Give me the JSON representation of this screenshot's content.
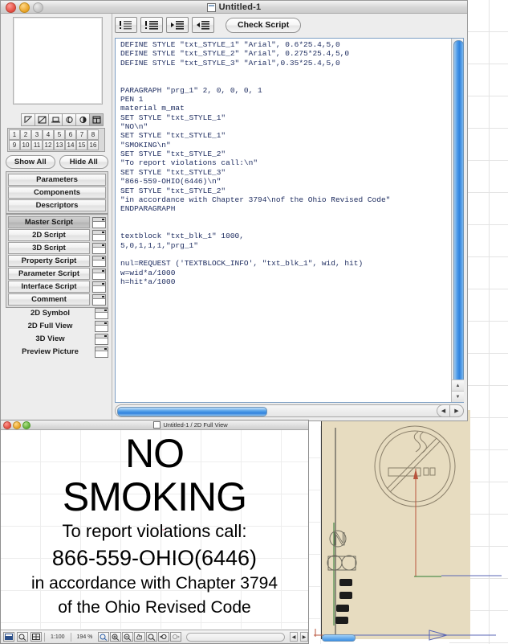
{
  "app": {
    "window_title": "Untitled-1",
    "doc_icon": "document-icon"
  },
  "toolbar": {
    "buttons": [
      {
        "name": "check-syntax-icon",
        "label": "!☷"
      },
      {
        "name": "line-numbers-icon",
        "label": "!≡"
      },
      {
        "name": "indent-right-icon",
        "label": "▶≡"
      },
      {
        "name": "indent-left-icon",
        "label": "◀≡"
      }
    ],
    "check_script_label": "Check Script"
  },
  "left_panel": {
    "preview_label": "preview-thumbnail",
    "icon_row": [
      {
        "name": "edit-pencil-icon",
        "glyph": "◱"
      },
      {
        "name": "fill-icon",
        "glyph": "▨"
      },
      {
        "name": "floor-plan-icon",
        "glyph": "⎔"
      },
      {
        "name": "globe-3d-icon",
        "glyph": "◔"
      },
      {
        "name": "shade-3d-icon",
        "glyph": "◕"
      },
      {
        "name": "script-window-icon",
        "glyph": "▤"
      }
    ],
    "numbers_row1": [
      "1",
      "2",
      "3",
      "4",
      "5",
      "6",
      "7",
      "8"
    ],
    "numbers_row2": [
      "9",
      "10",
      "11",
      "12",
      "13",
      "14",
      "15",
      "16"
    ],
    "show_all_label": "Show All",
    "hide_all_label": "Hide All",
    "top_group": [
      {
        "label": "Parameters",
        "selected": false
      },
      {
        "label": "Components",
        "selected": false
      },
      {
        "label": "Descriptors",
        "selected": false
      }
    ],
    "script_group": [
      {
        "label": "Master Script",
        "selected": true
      },
      {
        "label": "2D Script",
        "selected": false
      },
      {
        "label": "3D Script",
        "selected": false
      },
      {
        "label": "Property Script",
        "selected": false
      },
      {
        "label": "Parameter Script",
        "selected": false
      },
      {
        "label": "Interface Script",
        "selected": false
      },
      {
        "label": "Comment",
        "selected": false
      }
    ],
    "views": [
      {
        "label": "2D Symbol"
      },
      {
        "label": "2D Full View"
      },
      {
        "label": "3D View"
      },
      {
        "label": "Preview Picture"
      }
    ]
  },
  "editor": {
    "code": "DEFINE STYLE \"txt_STYLE_1\" \"Arial\", 0.6*25.4,5,0\nDEFINE STYLE \"txt_STYLE_2\" \"Arial\", 0.275*25.4,5,0\nDEFINE STYLE \"txt_STYLE_3\" \"Arial\",0.35*25.4,5,0\n\n\nPARAGRAPH \"prg_1\" 2, 0, 0, 0, 1\nPEN 1\nmaterial m_mat\nSET STYLE \"txt_STYLE_1\"\n\"NO\\n\"\nSET STYLE \"txt_STYLE_1\"\n\"SMOKING\\n\"\nSET STYLE \"txt_STYLE_2\"\n\"To report violations call:\\n\"\nSET STYLE \"txt_STYLE_3\"\n\"866-559-OHIO(6446)\\n\"\nSET STYLE \"txt_STYLE_2\"\n\"in accordance with Chapter 3794\\nof the Ohio Revised Code\"\nENDPARAGRAPH\n\n\ntextblock \"txt_blk_1\" 1000,\n5,0,1,1,1,\"prg_1\"\n\nnul=REQUEST ('TEXTBLOCK_INFO', \"txt_blk_1\", wid, hit)\nw=wid*a/1000\nh=hit*a/1000",
    "text_color": "#1b2a5e"
  },
  "view2d": {
    "title": "Untitled-1 / 2D Full View",
    "sign_lines": [
      "NO",
      "SMOKING",
      "To report violations call:",
      "866-559-OHIO(6446)",
      "in accordance with Chapter 3794",
      "of the Ohio Revised Code"
    ],
    "status": {
      "scale": "1:100",
      "zoom": "194 %",
      "tool_icons": [
        {
          "name": "layer-icon",
          "glyph": "▤"
        },
        {
          "name": "zoom-fit-icon",
          "glyph": "⌕"
        },
        {
          "name": "grid-icon",
          "glyph": "▦"
        }
      ],
      "zoom_tools": [
        {
          "name": "zoom-selected-icon",
          "glyph": "⌕"
        },
        {
          "name": "zoom-in-icon",
          "glyph": "⌕"
        },
        {
          "name": "zoom-out-icon",
          "glyph": "⌕"
        },
        {
          "name": "pan-hand-icon",
          "glyph": "✋"
        },
        {
          "name": "zoom-fit-window-icon",
          "glyph": "⌕"
        },
        {
          "name": "zoom-prev-icon",
          "glyph": "⌕"
        },
        {
          "name": "zoom-next-icon",
          "glyph": "⌕"
        }
      ],
      "arrow_left": "◀",
      "arrow_right": "▶"
    }
  },
  "cad": {
    "sheet_color": "#e7dcc0",
    "symbol": "no-smoking-symbol",
    "dimension_color": "#b8543c"
  },
  "colors": {
    "accent": "#2f81dd",
    "window_chrome": "#ededed",
    "code_blue": "#1b2a5e"
  }
}
